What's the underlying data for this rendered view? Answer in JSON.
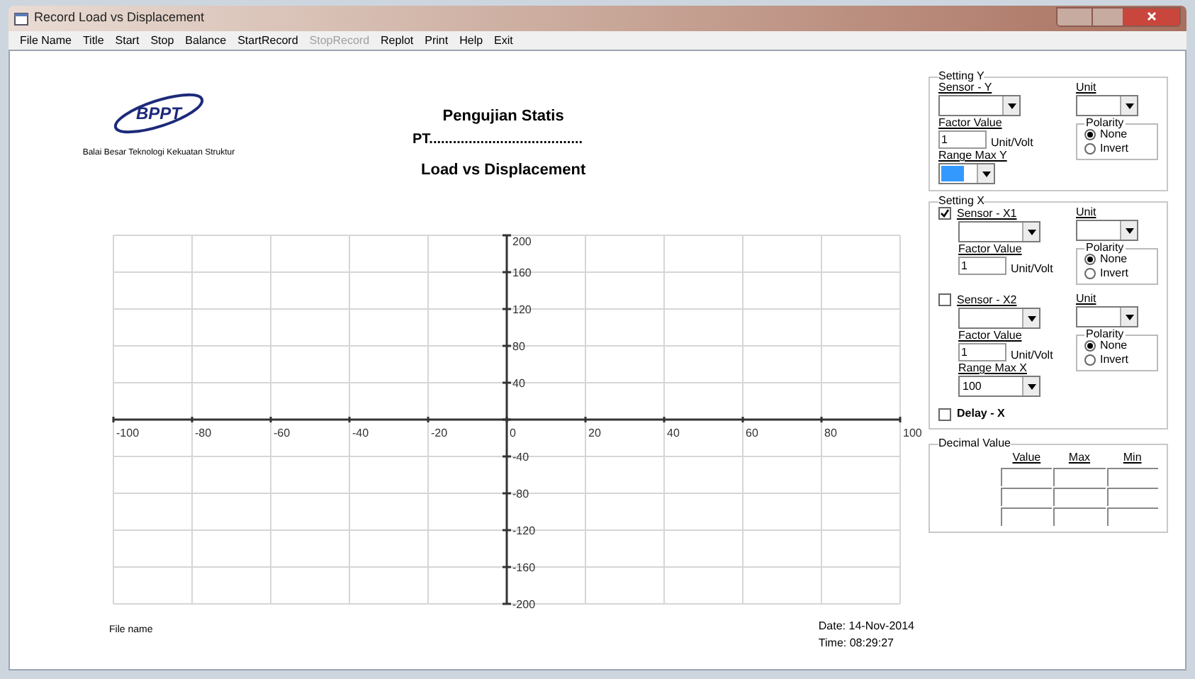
{
  "window": {
    "title": "Record Load vs Displacement"
  },
  "menu": [
    {
      "label": "File Name",
      "disabled": false
    },
    {
      "label": "Title",
      "disabled": false
    },
    {
      "label": "Start",
      "disabled": false
    },
    {
      "label": "Stop",
      "disabled": false
    },
    {
      "label": "Balance",
      "disabled": false
    },
    {
      "label": "StartRecord",
      "disabled": false
    },
    {
      "label": "StopRecord",
      "disabled": true
    },
    {
      "label": "Replot",
      "disabled": false
    },
    {
      "label": "Print",
      "disabled": false
    },
    {
      "label": "Help",
      "disabled": false
    },
    {
      "label": "Exit",
      "disabled": false
    }
  ],
  "header": {
    "logo_text": "BPPT",
    "org_name": "Balai Besar Teknologi Kekuatan Struktur",
    "title": "Pengujian Statis",
    "pt_line": "PT.......................................",
    "chart_title": "Load vs Displacement"
  },
  "chart": {
    "x_tick_labels": [
      "-100",
      "-80",
      "-60",
      "-40",
      "-20",
      "0",
      "20",
      "40",
      "60",
      "80",
      "100"
    ],
    "y_tick_labels": [
      "200",
      "160",
      "120",
      "80",
      "40",
      "-40",
      "-80",
      "-120",
      "-160",
      "-200"
    ]
  },
  "footer": {
    "file_name": "File name",
    "date": "Date: 14-Nov-2014",
    "time": "Time: 08:29:27"
  },
  "setting_y": {
    "title": "Setting Y",
    "sensor_label": "Sensor - Y",
    "unit_label": "Unit",
    "factor_label": "Factor Value",
    "factor_value": "1",
    "unit_per_volt": "Unit/Volt",
    "polarity": {
      "title": "Polarity",
      "options": [
        {
          "label": "None",
          "selected": true
        },
        {
          "label": "Invert",
          "selected": false
        }
      ]
    },
    "range_label": "Range Max Y",
    "range_highlighted": true
  },
  "setting_x": {
    "title": "Setting X",
    "sensors": [
      {
        "label": "Sensor - X1",
        "checked": true,
        "unit_label": "Unit",
        "factor_label": "Factor Value",
        "factor_value": "1",
        "unit_per_volt": "Unit/Volt",
        "polarity": {
          "title": "Polarity",
          "options": [
            {
              "label": "None",
              "selected": true
            },
            {
              "label": "Invert",
              "selected": false
            }
          ]
        }
      },
      {
        "label": "Sensor - X2",
        "checked": false,
        "unit_label": "Unit",
        "factor_label": "Factor Value",
        "factor_value": "1",
        "unit_per_volt": "Unit/Volt",
        "polarity": {
          "title": "Polarity",
          "options": [
            {
              "label": "None",
              "selected": true
            },
            {
              "label": "Invert",
              "selected": false
            }
          ]
        },
        "range_label": "Range Max X",
        "range_value": "100"
      }
    ],
    "delay": {
      "label": "Delay - X",
      "checked": false
    }
  },
  "decimal": {
    "title": "Decimal Value",
    "columns": [
      "Value",
      "Max",
      "Min"
    ]
  }
}
